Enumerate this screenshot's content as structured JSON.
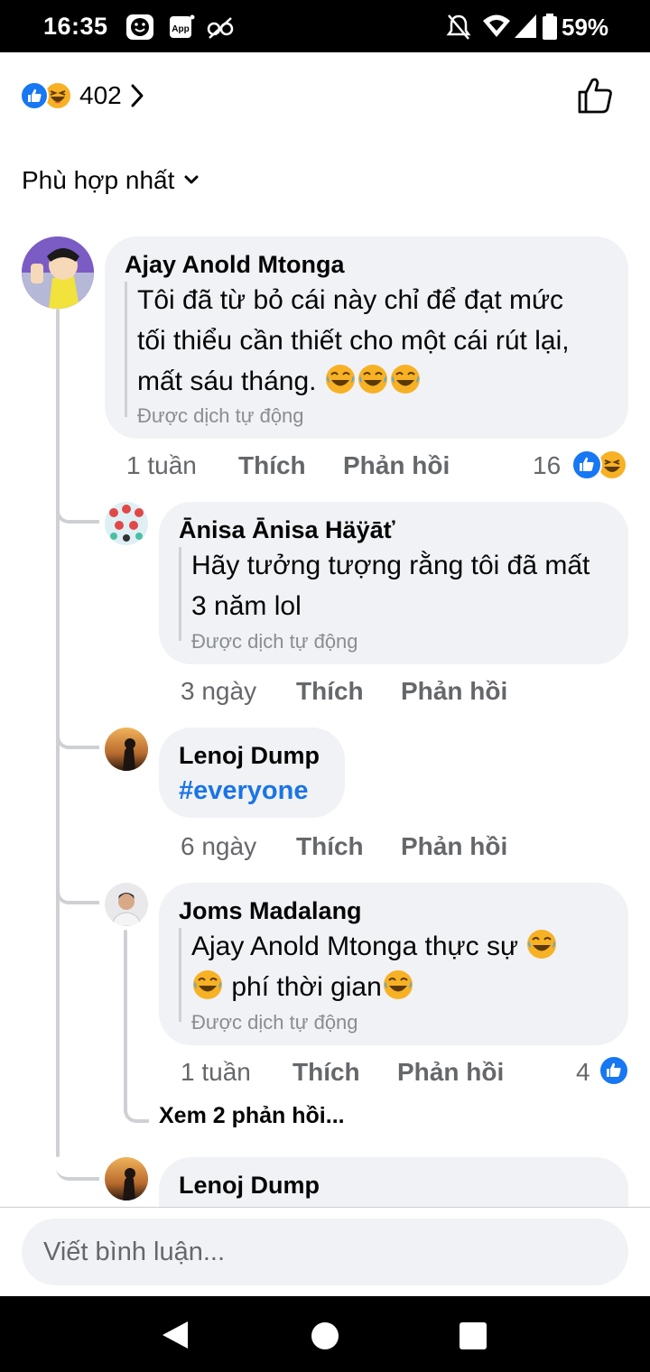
{
  "status_bar": {
    "time": "16:35",
    "battery": "59%",
    "icons": [
      "face-notification-icon",
      "app-notification-icon",
      "no-signal-icon",
      "mute-icon",
      "wifi-icon",
      "cell-signal-icon",
      "battery-icon"
    ]
  },
  "reactions": {
    "count": "402",
    "types": [
      "like",
      "haha"
    ]
  },
  "sort": {
    "label": "Phù hợp nhất"
  },
  "comments": [
    {
      "author": "Ajay Anold Mtonga",
      "text_lines": [
        "Tôi đã từ bỏ cái này chỉ để đạt mức",
        "tối thiểu cần thiết cho một cái rút lại,",
        "mất sáu tháng."
      ],
      "auto_translated": "Được dịch tự động",
      "time": "1 tuần",
      "like": "Thích",
      "reply": "Phản hồi",
      "reaction_count": "16"
    },
    {
      "author": "Ānisa Ānisa Häÿāť",
      "text_lines": [
        "Hãy tưởng tượng rằng tôi đã mất",
        "3 năm lol"
      ],
      "auto_translated": "Được dịch tự động",
      "time": "3 ngày",
      "like": "Thích",
      "reply": "Phản hồi"
    },
    {
      "author": "Lenoj Dump",
      "hashtag": "#everyone",
      "time": "6 ngày",
      "like": "Thích",
      "reply": "Phản hồi"
    },
    {
      "author": "Joms Madalang",
      "text_lines": [
        "Ajay Anold Mtonga thực sự",
        "phí thời gian"
      ],
      "auto_translated": "Được dịch tự động",
      "time": "1 tuần",
      "like": "Thích",
      "reply": "Phản hồi",
      "reaction_count": "4",
      "more_replies": "Xem 2 phản hồi..."
    },
    {
      "author": "Lenoj Dump"
    }
  ],
  "composer": {
    "placeholder": "Viết bình luận..."
  },
  "colors": {
    "like_blue": "#1877f2",
    "haha_yellow": "#f7b125",
    "bubble_bg": "#f0f2f5",
    "meta_gray": "#65676b",
    "hashtag_blue": "#1b74e4"
  }
}
